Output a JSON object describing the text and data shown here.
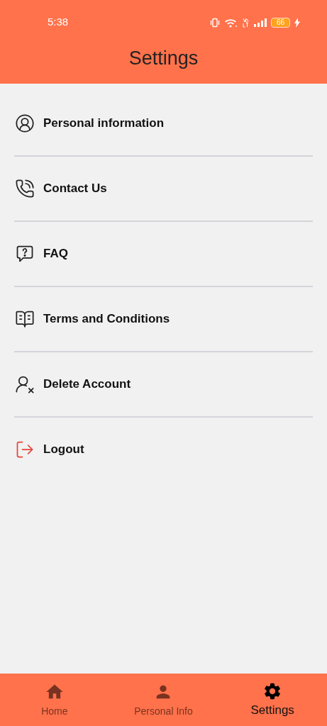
{
  "status_bar": {
    "time": "5:38",
    "battery": "66"
  },
  "header": {
    "title": "Settings"
  },
  "menu": [
    {
      "kind": "profile",
      "label": "Personal information"
    },
    {
      "kind": "phone",
      "label": "Contact Us"
    },
    {
      "kind": "faq",
      "label": "FAQ"
    },
    {
      "kind": "book",
      "label": "Terms and Conditions"
    },
    {
      "kind": "delete-user",
      "label": "Delete Account"
    },
    {
      "kind": "logout",
      "label": "Logout"
    }
  ],
  "bottom_nav": [
    {
      "kind": "home",
      "label": "Home",
      "selected": false
    },
    {
      "kind": "person",
      "label": "Personal Info",
      "selected": false
    },
    {
      "kind": "settings",
      "label": "Settings",
      "selected": true
    }
  ]
}
